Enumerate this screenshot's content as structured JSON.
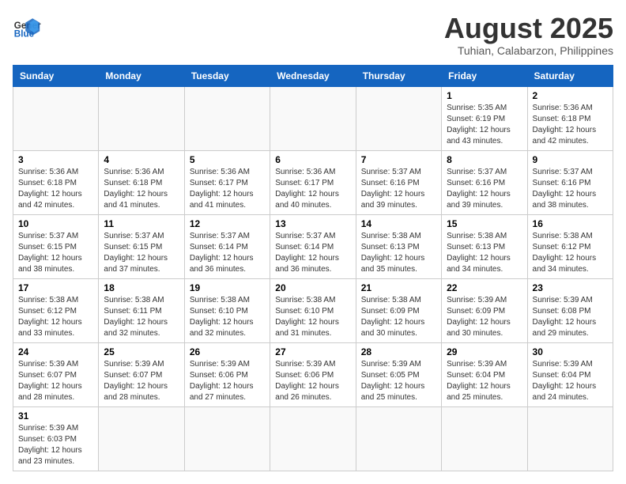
{
  "header": {
    "logo_text_general": "General",
    "logo_text_blue": "Blue",
    "main_title": "August 2025",
    "subtitle": "Tuhian, Calabarzon, Philippines"
  },
  "days_of_week": [
    "Sunday",
    "Monday",
    "Tuesday",
    "Wednesday",
    "Thursday",
    "Friday",
    "Saturday"
  ],
  "weeks": [
    [
      {
        "day": "",
        "info": ""
      },
      {
        "day": "",
        "info": ""
      },
      {
        "day": "",
        "info": ""
      },
      {
        "day": "",
        "info": ""
      },
      {
        "day": "",
        "info": ""
      },
      {
        "day": "1",
        "info": "Sunrise: 5:35 AM\nSunset: 6:19 PM\nDaylight: 12 hours and 43 minutes."
      },
      {
        "day": "2",
        "info": "Sunrise: 5:36 AM\nSunset: 6:18 PM\nDaylight: 12 hours and 42 minutes."
      }
    ],
    [
      {
        "day": "3",
        "info": "Sunrise: 5:36 AM\nSunset: 6:18 PM\nDaylight: 12 hours and 42 minutes."
      },
      {
        "day": "4",
        "info": "Sunrise: 5:36 AM\nSunset: 6:18 PM\nDaylight: 12 hours and 41 minutes."
      },
      {
        "day": "5",
        "info": "Sunrise: 5:36 AM\nSunset: 6:17 PM\nDaylight: 12 hours and 41 minutes."
      },
      {
        "day": "6",
        "info": "Sunrise: 5:36 AM\nSunset: 6:17 PM\nDaylight: 12 hours and 40 minutes."
      },
      {
        "day": "7",
        "info": "Sunrise: 5:37 AM\nSunset: 6:16 PM\nDaylight: 12 hours and 39 minutes."
      },
      {
        "day": "8",
        "info": "Sunrise: 5:37 AM\nSunset: 6:16 PM\nDaylight: 12 hours and 39 minutes."
      },
      {
        "day": "9",
        "info": "Sunrise: 5:37 AM\nSunset: 6:16 PM\nDaylight: 12 hours and 38 minutes."
      }
    ],
    [
      {
        "day": "10",
        "info": "Sunrise: 5:37 AM\nSunset: 6:15 PM\nDaylight: 12 hours and 38 minutes."
      },
      {
        "day": "11",
        "info": "Sunrise: 5:37 AM\nSunset: 6:15 PM\nDaylight: 12 hours and 37 minutes."
      },
      {
        "day": "12",
        "info": "Sunrise: 5:37 AM\nSunset: 6:14 PM\nDaylight: 12 hours and 36 minutes."
      },
      {
        "day": "13",
        "info": "Sunrise: 5:37 AM\nSunset: 6:14 PM\nDaylight: 12 hours and 36 minutes."
      },
      {
        "day": "14",
        "info": "Sunrise: 5:38 AM\nSunset: 6:13 PM\nDaylight: 12 hours and 35 minutes."
      },
      {
        "day": "15",
        "info": "Sunrise: 5:38 AM\nSunset: 6:13 PM\nDaylight: 12 hours and 34 minutes."
      },
      {
        "day": "16",
        "info": "Sunrise: 5:38 AM\nSunset: 6:12 PM\nDaylight: 12 hours and 34 minutes."
      }
    ],
    [
      {
        "day": "17",
        "info": "Sunrise: 5:38 AM\nSunset: 6:12 PM\nDaylight: 12 hours and 33 minutes."
      },
      {
        "day": "18",
        "info": "Sunrise: 5:38 AM\nSunset: 6:11 PM\nDaylight: 12 hours and 32 minutes."
      },
      {
        "day": "19",
        "info": "Sunrise: 5:38 AM\nSunset: 6:10 PM\nDaylight: 12 hours and 32 minutes."
      },
      {
        "day": "20",
        "info": "Sunrise: 5:38 AM\nSunset: 6:10 PM\nDaylight: 12 hours and 31 minutes."
      },
      {
        "day": "21",
        "info": "Sunrise: 5:38 AM\nSunset: 6:09 PM\nDaylight: 12 hours and 30 minutes."
      },
      {
        "day": "22",
        "info": "Sunrise: 5:39 AM\nSunset: 6:09 PM\nDaylight: 12 hours and 30 minutes."
      },
      {
        "day": "23",
        "info": "Sunrise: 5:39 AM\nSunset: 6:08 PM\nDaylight: 12 hours and 29 minutes."
      }
    ],
    [
      {
        "day": "24",
        "info": "Sunrise: 5:39 AM\nSunset: 6:07 PM\nDaylight: 12 hours and 28 minutes."
      },
      {
        "day": "25",
        "info": "Sunrise: 5:39 AM\nSunset: 6:07 PM\nDaylight: 12 hours and 28 minutes."
      },
      {
        "day": "26",
        "info": "Sunrise: 5:39 AM\nSunset: 6:06 PM\nDaylight: 12 hours and 27 minutes."
      },
      {
        "day": "27",
        "info": "Sunrise: 5:39 AM\nSunset: 6:06 PM\nDaylight: 12 hours and 26 minutes."
      },
      {
        "day": "28",
        "info": "Sunrise: 5:39 AM\nSunset: 6:05 PM\nDaylight: 12 hours and 25 minutes."
      },
      {
        "day": "29",
        "info": "Sunrise: 5:39 AM\nSunset: 6:04 PM\nDaylight: 12 hours and 25 minutes."
      },
      {
        "day": "30",
        "info": "Sunrise: 5:39 AM\nSunset: 6:04 PM\nDaylight: 12 hours and 24 minutes."
      }
    ],
    [
      {
        "day": "31",
        "info": "Sunrise: 5:39 AM\nSunset: 6:03 PM\nDaylight: 12 hours and 23 minutes."
      },
      {
        "day": "",
        "info": ""
      },
      {
        "day": "",
        "info": ""
      },
      {
        "day": "",
        "info": ""
      },
      {
        "day": "",
        "info": ""
      },
      {
        "day": "",
        "info": ""
      },
      {
        "day": "",
        "info": ""
      }
    ]
  ]
}
